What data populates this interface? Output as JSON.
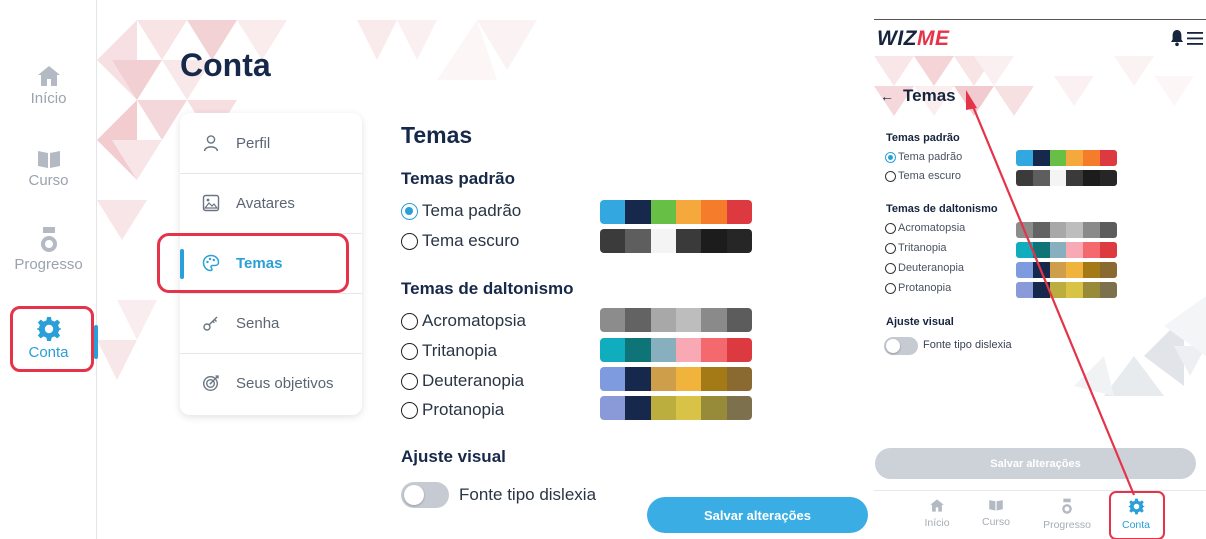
{
  "left_rail": {
    "items": [
      {
        "label": "Início",
        "icon": "home-icon"
      },
      {
        "label": "Curso",
        "icon": "book-icon"
      },
      {
        "label": "Progresso",
        "icon": "medal-icon"
      },
      {
        "label": "Conta",
        "icon": "gear-icon"
      }
    ],
    "active": "Conta"
  },
  "page": {
    "title": "Conta"
  },
  "settings_menu": {
    "items": [
      {
        "label": "Perfil",
        "icon": "person-icon"
      },
      {
        "label": "Avatares",
        "icon": "image-icon"
      },
      {
        "label": "Temas",
        "icon": "palette-icon"
      },
      {
        "label": "Senha",
        "icon": "key-icon"
      },
      {
        "label": "Seus objetivos",
        "icon": "target-icon"
      }
    ],
    "active": "Temas"
  },
  "themes": {
    "title": "Temas",
    "standard_heading": "Temas padrão",
    "standard_options": [
      {
        "label": "Tema padrão",
        "selected": true,
        "colors": [
          "#33a8e0",
          "#16294d",
          "#68bf45",
          "#f5a83c",
          "#f47c2b",
          "#dc3a40"
        ]
      },
      {
        "label": "Tema escuro",
        "selected": false,
        "colors": [
          "#3b3b3b",
          "#5e5e5e",
          "#f4f4f4",
          "#3a3a3a",
          "#1c1c1c",
          "#262626"
        ]
      }
    ],
    "colorblind_heading": "Temas de daltonismo",
    "colorblind_options": [
      {
        "label": "Acromatopsia",
        "selected": false,
        "colors": [
          "#8c8c8c",
          "#636363",
          "#a8a8a8",
          "#bdbdbd",
          "#8a8a8a",
          "#5c5c5c"
        ]
      },
      {
        "label": "Tritanopia",
        "selected": false,
        "colors": [
          "#0fadbd",
          "#0f7478",
          "#87afbd",
          "#f8a9b3",
          "#f4696e",
          "#dc3a40"
        ]
      },
      {
        "label": "Deuteranopia",
        "selected": false,
        "colors": [
          "#7f9be0",
          "#16294d",
          "#cf9e4b",
          "#f0b43c",
          "#a47a16",
          "#8b6a31"
        ]
      },
      {
        "label": "Protanopia",
        "selected": false,
        "colors": [
          "#8a9ad9",
          "#16294d",
          "#bcad3f",
          "#d8c347",
          "#978a38",
          "#7d714d"
        ]
      }
    ],
    "visual_heading": "Ajuste visual",
    "dyslexia_label": "Fonte tipo dislexia",
    "dyslexia_enabled": false,
    "save_label": "Salvar alterações"
  },
  "phone": {
    "logo_a": "WIZ",
    "logo_b": "ME",
    "back_glyph": "←",
    "title": "Temas",
    "save_label": "Salvar alterações",
    "nav": [
      {
        "label": "Início",
        "icon": "home-icon"
      },
      {
        "label": "Curso",
        "icon": "book-icon"
      },
      {
        "label": "Progresso",
        "icon": "medal-icon"
      },
      {
        "label": "Conta",
        "icon": "gear-icon"
      }
    ],
    "active_nav": "Conta"
  },
  "colors": {
    "accent": "#2a9fd8",
    "highlight": "#e53349",
    "navy": "#17294a"
  }
}
